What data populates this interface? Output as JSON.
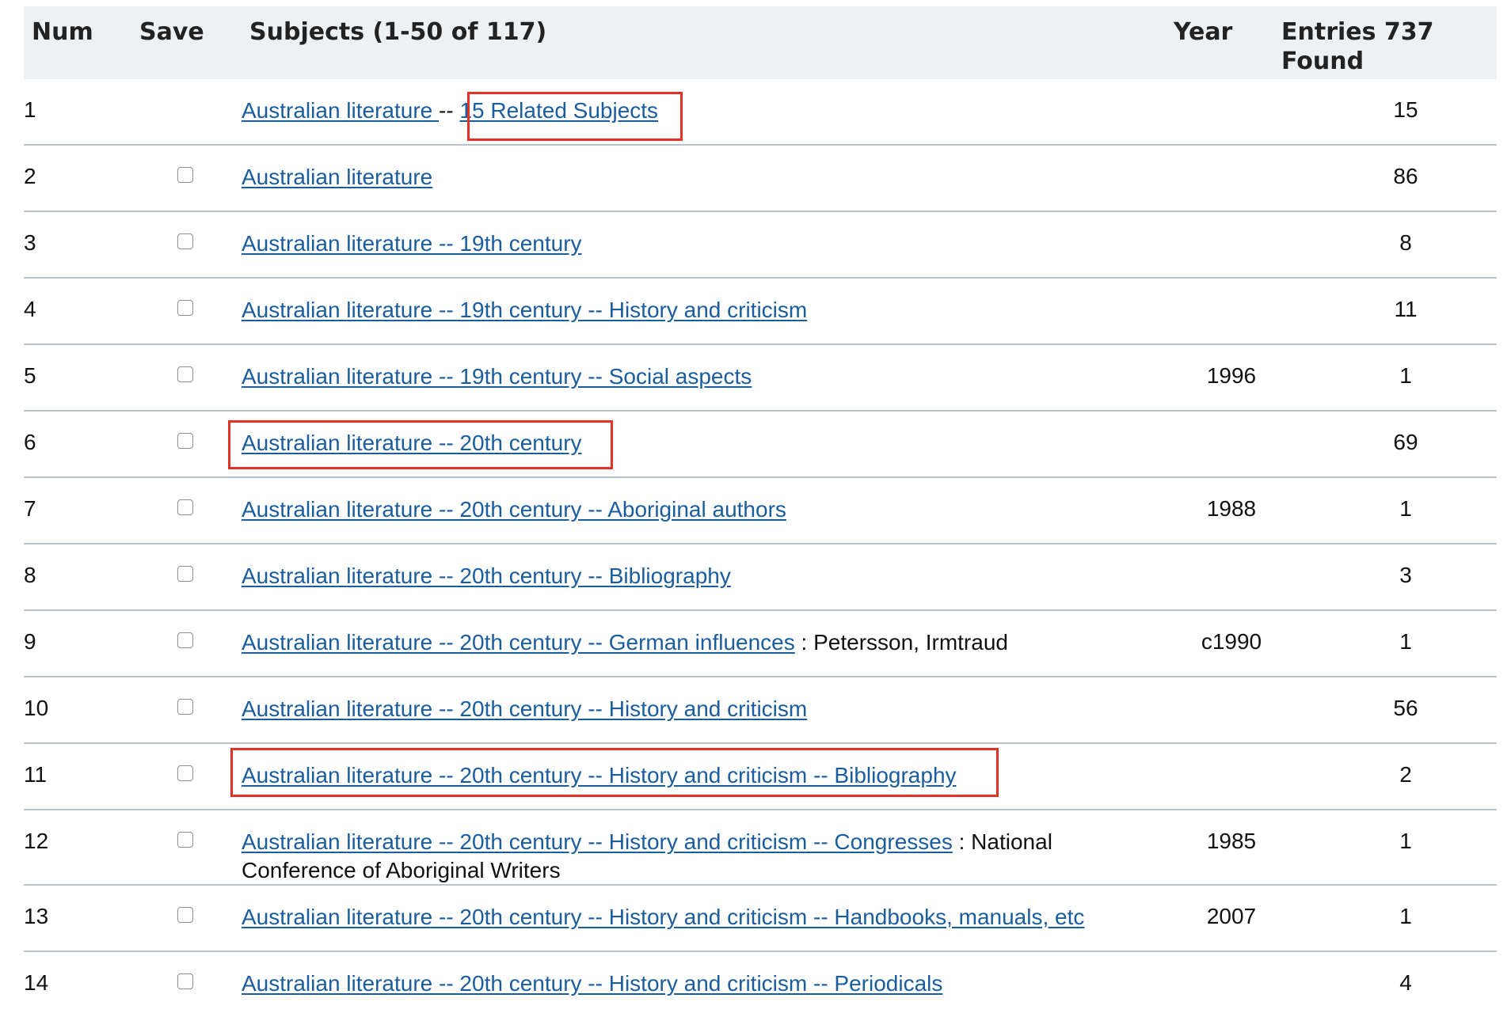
{
  "columns": {
    "num": "Num",
    "save": "Save",
    "subjects": "Subjects (1-50 of 117)",
    "year": "Year",
    "entries_line1": "Entries 737",
    "entries_line2": "Found"
  },
  "rows": [
    {
      "num": "1",
      "link": "Australian literature ",
      "sep": "--",
      "related_link": "15 Related Subjects",
      "year": "",
      "entries": "15",
      "has_save": false
    },
    {
      "num": "2",
      "link": "Australian literature",
      "year": "",
      "entries": "86",
      "has_save": true
    },
    {
      "num": "3",
      "link": "Australian literature -- 19th century",
      "year": "",
      "entries": "8",
      "has_save": true
    },
    {
      "num": "4",
      "link": "Australian literature -- 19th century -- History and criticism",
      "year": "",
      "entries": "11",
      "has_save": true
    },
    {
      "num": "5",
      "link": "Australian literature -- 19th century -- Social aspects",
      "year": "1996",
      "entries": "1",
      "has_save": true
    },
    {
      "num": "6",
      "link": "Australian literature -- 20th century",
      "year": "",
      "entries": "69",
      "has_save": true
    },
    {
      "num": "7",
      "link": "Australian literature -- 20th century -- Aboriginal authors",
      "year": "1988",
      "entries": "1",
      "has_save": true
    },
    {
      "num": "8",
      "link": "Australian literature -- 20th century -- Bibliography",
      "year": "",
      "entries": "3",
      "has_save": true
    },
    {
      "num": "9",
      "link": "Australian literature -- 20th century -- German influences",
      "suffix": " : Petersson, Irmtraud",
      "year": "c1990",
      "entries": "1",
      "has_save": true
    },
    {
      "num": "10",
      "link": "Australian literature -- 20th century -- History and criticism",
      "year": "",
      "entries": "56",
      "has_save": true
    },
    {
      "num": "11",
      "link": "Australian literature -- 20th century -- History and criticism -- Bibliography",
      "year": "",
      "entries": "2",
      "has_save": true
    },
    {
      "num": "12",
      "link": "Australian literature -- 20th century -- History and criticism -- Congresses",
      "suffix": " : National Conference of Aboriginal Writers",
      "year": "1985",
      "entries": "1",
      "has_save": true
    },
    {
      "num": "13",
      "link": "Australian literature -- 20th century -- History and criticism -- Handbooks, manuals, etc",
      "year": "2007",
      "entries": "1",
      "has_save": true
    },
    {
      "num": "14",
      "link": "Australian literature -- 20th century -- History and criticism -- Periodicals",
      "year": "",
      "entries": "4",
      "has_save": true
    }
  ],
  "colors": {
    "link": "#1a5d9e",
    "header_bg": "#eef1f4",
    "highlight": "#e53224",
    "row_divider": "#b9c3cc"
  }
}
